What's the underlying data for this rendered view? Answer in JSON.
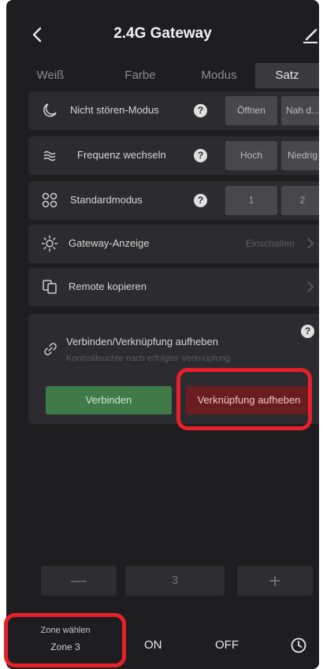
{
  "header": {
    "title": "2.4G Gateway"
  },
  "tabs": [
    {
      "label": "Weiß"
    },
    {
      "label": "Farbe"
    },
    {
      "label": "Modus"
    },
    {
      "label": "Satz"
    }
  ],
  "settings": {
    "dnd": {
      "label": "Nicht stören-Modus",
      "options": [
        "Öffnen",
        "Nah d..."
      ]
    },
    "frequency": {
      "label": "Frequenz wechseln",
      "options": [
        "Hoch",
        "Niedrig"
      ]
    },
    "standard": {
      "label": "Standardmodus",
      "options": [
        "1",
        "2"
      ]
    },
    "indicator": {
      "label": "Gateway-Anzeige",
      "value": "Einschalten"
    },
    "copy_remote": {
      "label": "Remote kopieren"
    },
    "link": {
      "title": "Verbinden/Verknüpfung aufheben",
      "subtitle": "Kontrollleuchte nach erfolgter Verknüpfung",
      "connect_label": "Verbinden",
      "unlink_label": "Verknüpfung aufheben"
    }
  },
  "stepper": {
    "minus": "—",
    "value": "3",
    "plus": "+"
  },
  "bottom_bar": {
    "zone_label": "Zone wählen",
    "zone_value": "Zone 3",
    "on_label": "ON",
    "off_label": "OFF"
  },
  "colors": {
    "background": "#1e1e20",
    "card": "#2c2c30",
    "connect_green": "#3f7a48",
    "unlink_red": "#6a1d20",
    "annotation_red": "#e8202a"
  }
}
